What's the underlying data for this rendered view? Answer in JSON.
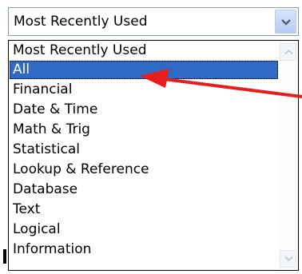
{
  "combo": {
    "value": "Most Recently Used"
  },
  "list": {
    "items": [
      "Most Recently Used",
      "All",
      "Financial",
      "Date & Time",
      "Math & Trig",
      "Statistical",
      "Lookup & Reference",
      "Database",
      "Text",
      "Logical",
      "Information"
    ],
    "selected": "All"
  },
  "colors": {
    "selection": "#316ac5",
    "arrow": "#e81c1c",
    "border": "#7f9db9"
  },
  "icons": {
    "dropdown": "chevron-down-icon",
    "scroll_up": "scroll-up-arrow-icon",
    "scroll_down": "scroll-down-arrow-icon",
    "annotation": "red-arrow-annotation"
  }
}
